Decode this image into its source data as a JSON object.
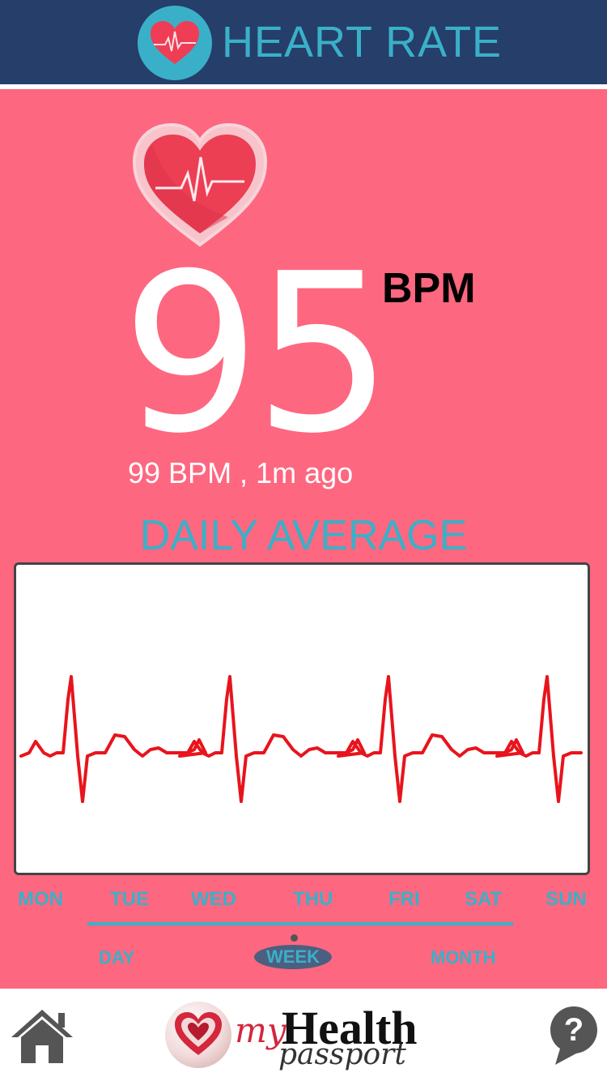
{
  "header": {
    "title": "HEART RATE",
    "logo_icon": "heart-pulse-icon"
  },
  "reading": {
    "value": "95",
    "unit": "BPM",
    "last": "99 BPM , 1m ago"
  },
  "section_title": "DAILY AVERAGE",
  "days": [
    "MON",
    "TUE",
    "WED",
    "THU",
    "FRI",
    "SAT",
    "SUN"
  ],
  "ranges": {
    "day": "DAY",
    "week": "WEEK",
    "month": "MONTH",
    "selected": "WEEK"
  },
  "brand": {
    "my": "my",
    "health": "Health",
    "passport": "passport"
  },
  "footer": {
    "home_icon": "home-icon",
    "help_icon": "help-icon",
    "help_glyph": "?"
  },
  "colors": {
    "header": "#253e6a",
    "accent": "#3ab0c8",
    "background": "#fe6780",
    "trace": "#e8141c"
  }
}
